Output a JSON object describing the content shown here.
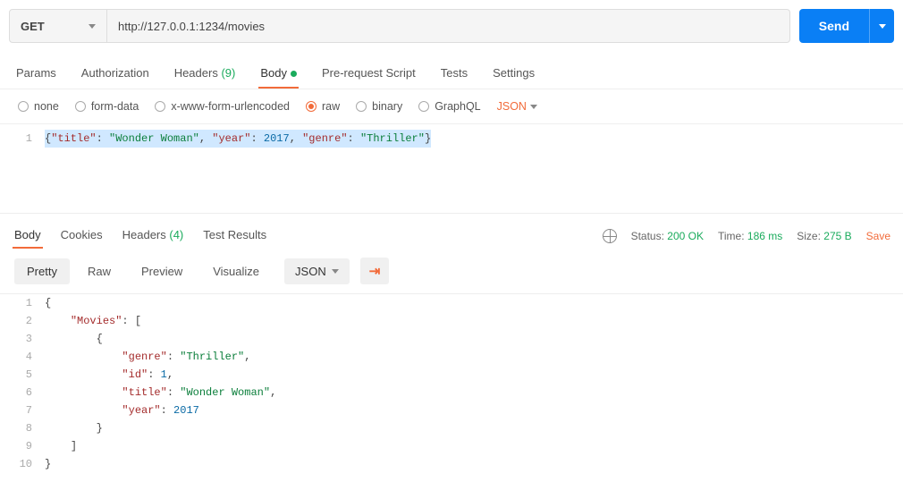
{
  "request": {
    "method": "GET",
    "url": "http://127.0.0.1:1234/movies",
    "send_label": "Send",
    "tabs": {
      "params": "Params",
      "auth": "Authorization",
      "headers": "Headers",
      "headers_count": "(9)",
      "body": "Body",
      "prerequest": "Pre-request Script",
      "tests": "Tests",
      "settings": "Settings"
    },
    "body_types": {
      "none": "none",
      "formdata": "form-data",
      "xwww": "x-www-form-urlencoded",
      "raw": "raw",
      "binary": "binary",
      "graphql": "GraphQL"
    },
    "raw_format": "JSON",
    "body_content": {
      "line1_num": "1",
      "title_key": "\"title\"",
      "title_val": "\"Wonder Woman\"",
      "year_key": "\"year\"",
      "year_val": "2017",
      "genre_key": "\"genre\"",
      "genre_val": "\"Thriller\""
    }
  },
  "response": {
    "tabs": {
      "body": "Body",
      "cookies": "Cookies",
      "headers": "Headers",
      "headers_count": "(4)",
      "tests": "Test Results"
    },
    "meta": {
      "status_label": "Status:",
      "status_value": "200 OK",
      "time_label": "Time:",
      "time_value": "186 ms",
      "size_label": "Size:",
      "size_value": "275 B",
      "save": "Save"
    },
    "views": {
      "pretty": "Pretty",
      "raw": "Raw",
      "preview": "Preview",
      "visualize": "Visualize",
      "format": "JSON"
    },
    "body_lines": {
      "l1": "1",
      "l2": "2",
      "l3": "3",
      "l4": "4",
      "l5": "5",
      "l6": "6",
      "l7": "7",
      "l8": "8",
      "l9": "9",
      "l10": "10",
      "brace_open": "{",
      "movies_key": "\"Movies\"",
      "arr_open": ": [",
      "obj_open": "{",
      "genre_k": "\"genre\"",
      "genre_v": "\"Thriller\"",
      "id_k": "\"id\"",
      "id_v": "1",
      "title_k": "\"title\"",
      "title_v": "\"Wonder Woman\"",
      "year_k": "\"year\"",
      "year_v": "2017",
      "obj_close": "}",
      "arr_close": "]",
      "brace_close": "}",
      "comma": ","
    }
  }
}
